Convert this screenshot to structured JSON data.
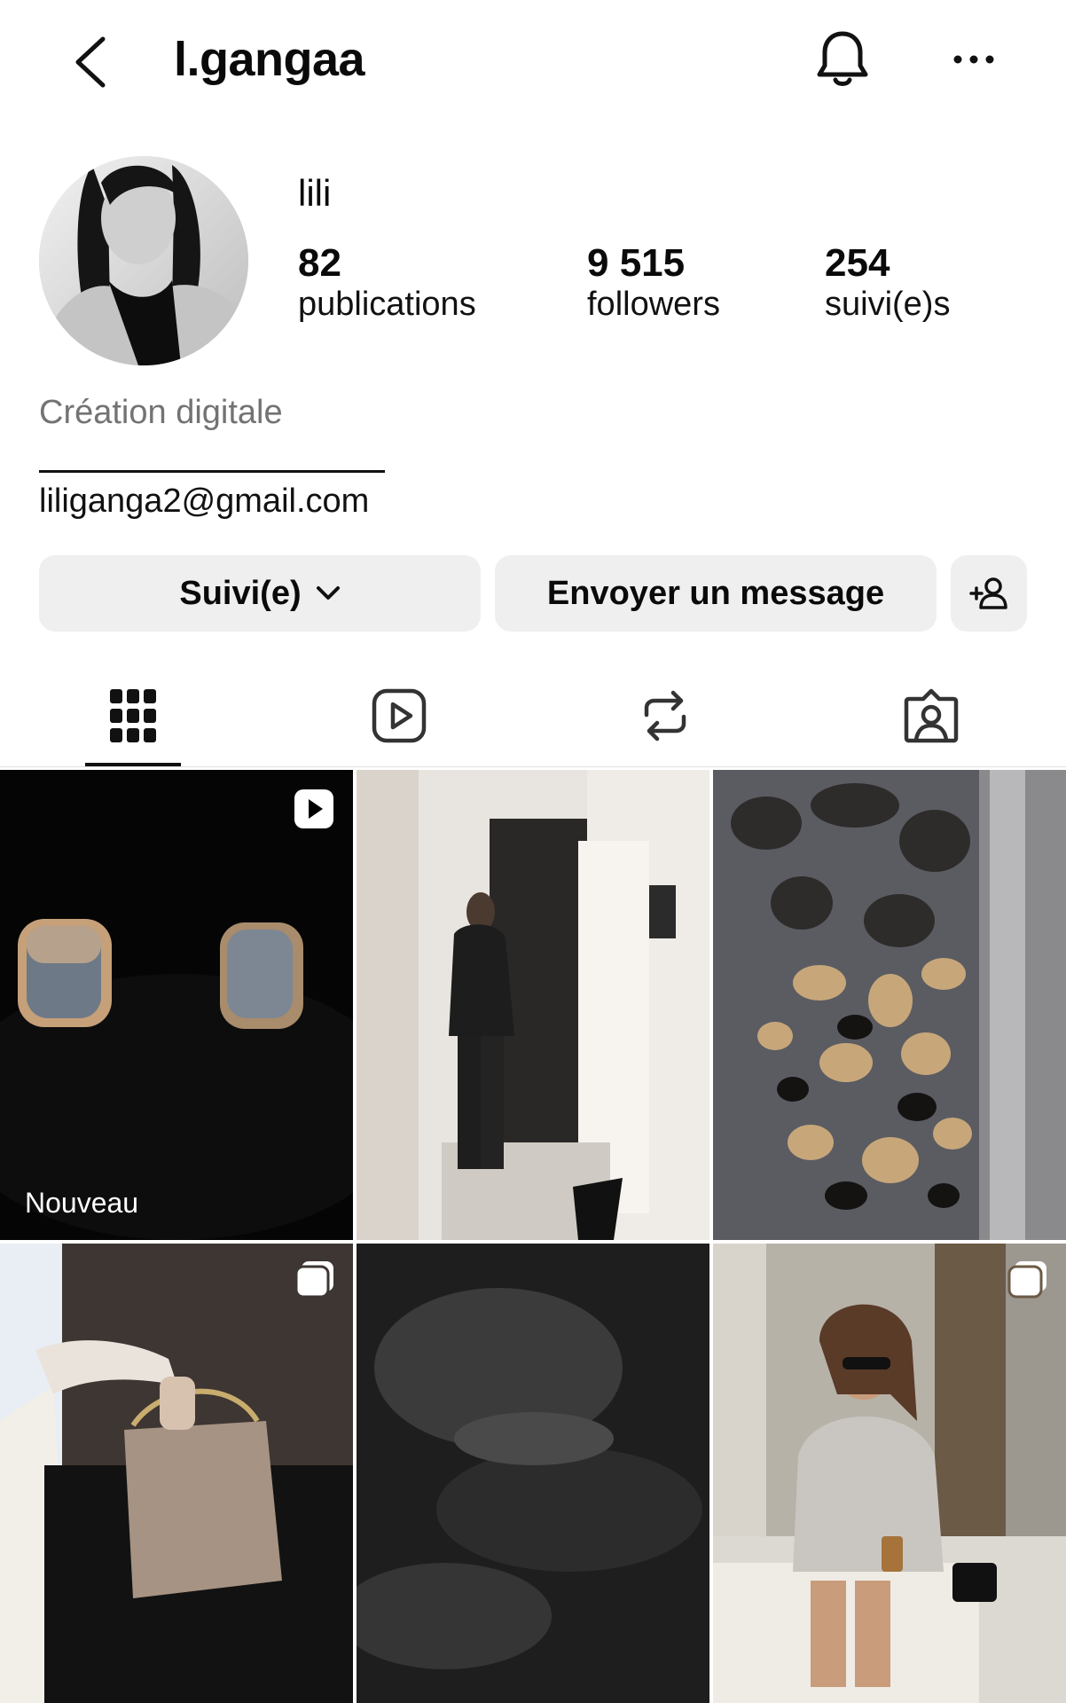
{
  "header": {
    "username": "l.gangaa",
    "icons": [
      "back-icon",
      "bell-icon",
      "more-options-icon"
    ]
  },
  "profile": {
    "display_name": "lili",
    "stats": [
      {
        "value": "82",
        "label": "publications"
      },
      {
        "value": "9 515",
        "label": "followers"
      },
      {
        "value": "254",
        "label": "suivi(e)s"
      }
    ],
    "category": "Création digitale",
    "email": "liliganga2@gmail.com"
  },
  "actions": {
    "following_label": "Suivi(e)",
    "message_label": "Envoyer un message",
    "suggest_icon": "add-person-icon"
  },
  "tabs": {
    "active": "posts-grid",
    "items": [
      "grid-icon",
      "reels-icon",
      "reposts-icon",
      "tagged-icon"
    ]
  },
  "grid": {
    "posts": [
      {
        "badge": "reel-icon",
        "label": "Nouveau"
      },
      {
        "badge": "",
        "label": ""
      },
      {
        "badge": "",
        "label": ""
      },
      {
        "badge": "carousel-icon",
        "label": ""
      },
      {
        "badge": "",
        "label": ""
      },
      {
        "badge": "carousel-icon",
        "label": ""
      }
    ]
  },
  "colors": {
    "text": "#0a0a0a",
    "secondary_text": "#737373",
    "button_bg": "#efefef"
  }
}
